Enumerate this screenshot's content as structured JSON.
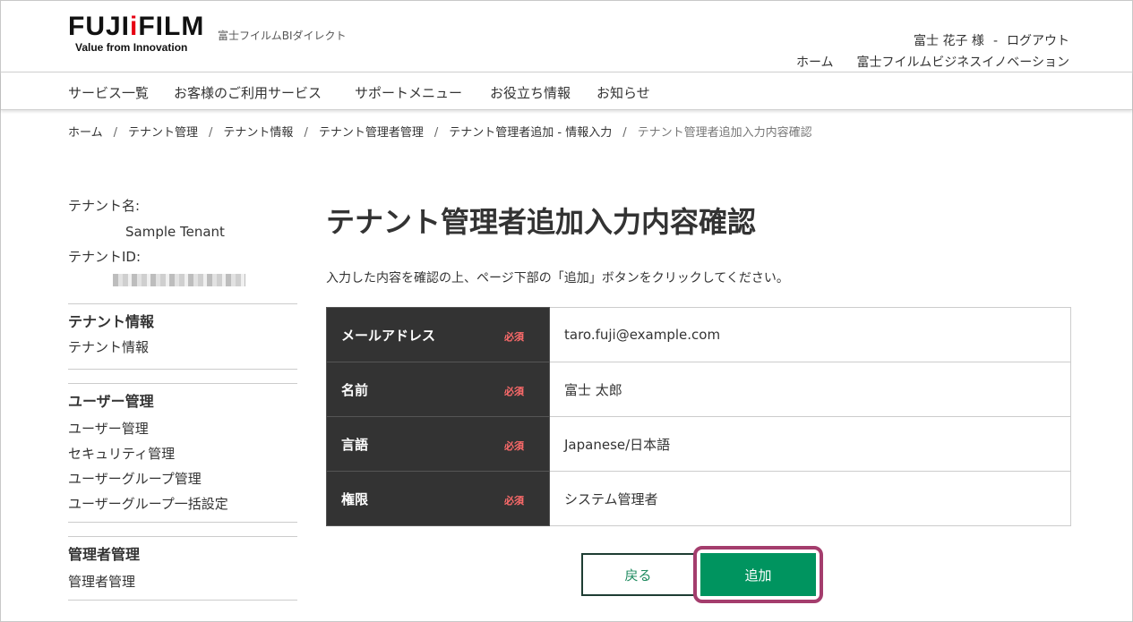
{
  "brand": {
    "logo_prefix": "FUJI",
    "logo_dot": "i",
    "logo_suffix": "FILM",
    "tagline": "Value from Innovation",
    "subname": "富士フイルムBIダイレクト"
  },
  "user": {
    "name": "富士 花子 様",
    "sep": "-",
    "logout": "ログアウト"
  },
  "top_links": [
    "ホーム",
    "富士フイルムビジネスイノベーション"
  ],
  "nav": [
    "サービス一覧",
    "お客様のご利用サービス",
    "サポートメニュー",
    "お役立ち情報",
    "お知らせ"
  ],
  "breadcrumb": [
    "ホーム",
    "テナント管理",
    "テナント情報",
    "テナント管理者管理",
    "テナント管理者追加 - 情報入力",
    "テナント管理者追加入力内容確認"
  ],
  "breadcrumb_sep": "/",
  "sidebar": {
    "tenant_name_label": "テナント名:",
    "tenant_name": "Sample Tenant",
    "tenant_id_label": "テナントID:",
    "sections": [
      {
        "heading": "テナント情報",
        "items": [
          "テナント情報"
        ]
      },
      {
        "heading": "ユーザー管理",
        "items": [
          "ユーザー管理",
          "セキュリティ管理",
          "ユーザーグループ管理",
          "ユーザーグループ一括設定"
        ]
      },
      {
        "heading": "管理者管理",
        "items": [
          "管理者管理"
        ]
      }
    ]
  },
  "main": {
    "title": "テナント管理者追加入力内容確認",
    "description": "入力した内容を確認の上、ページ下部の「追加」ボタンをクリックしてください。",
    "required_label": "必須",
    "rows": [
      {
        "label": "メールアドレス",
        "value": "taro.fuji@example.com"
      },
      {
        "label": "名前",
        "value": "富士 太郎"
      },
      {
        "label": "言語",
        "value": "Japanese/日本語"
      },
      {
        "label": "権限",
        "value": "システム管理者"
      }
    ],
    "back_label": "戻る",
    "add_label": "追加"
  },
  "colors": {
    "accent": "#00945f",
    "highlight": "#a43d6d",
    "required": "#ff6b6b",
    "table_header": "#333333"
  }
}
